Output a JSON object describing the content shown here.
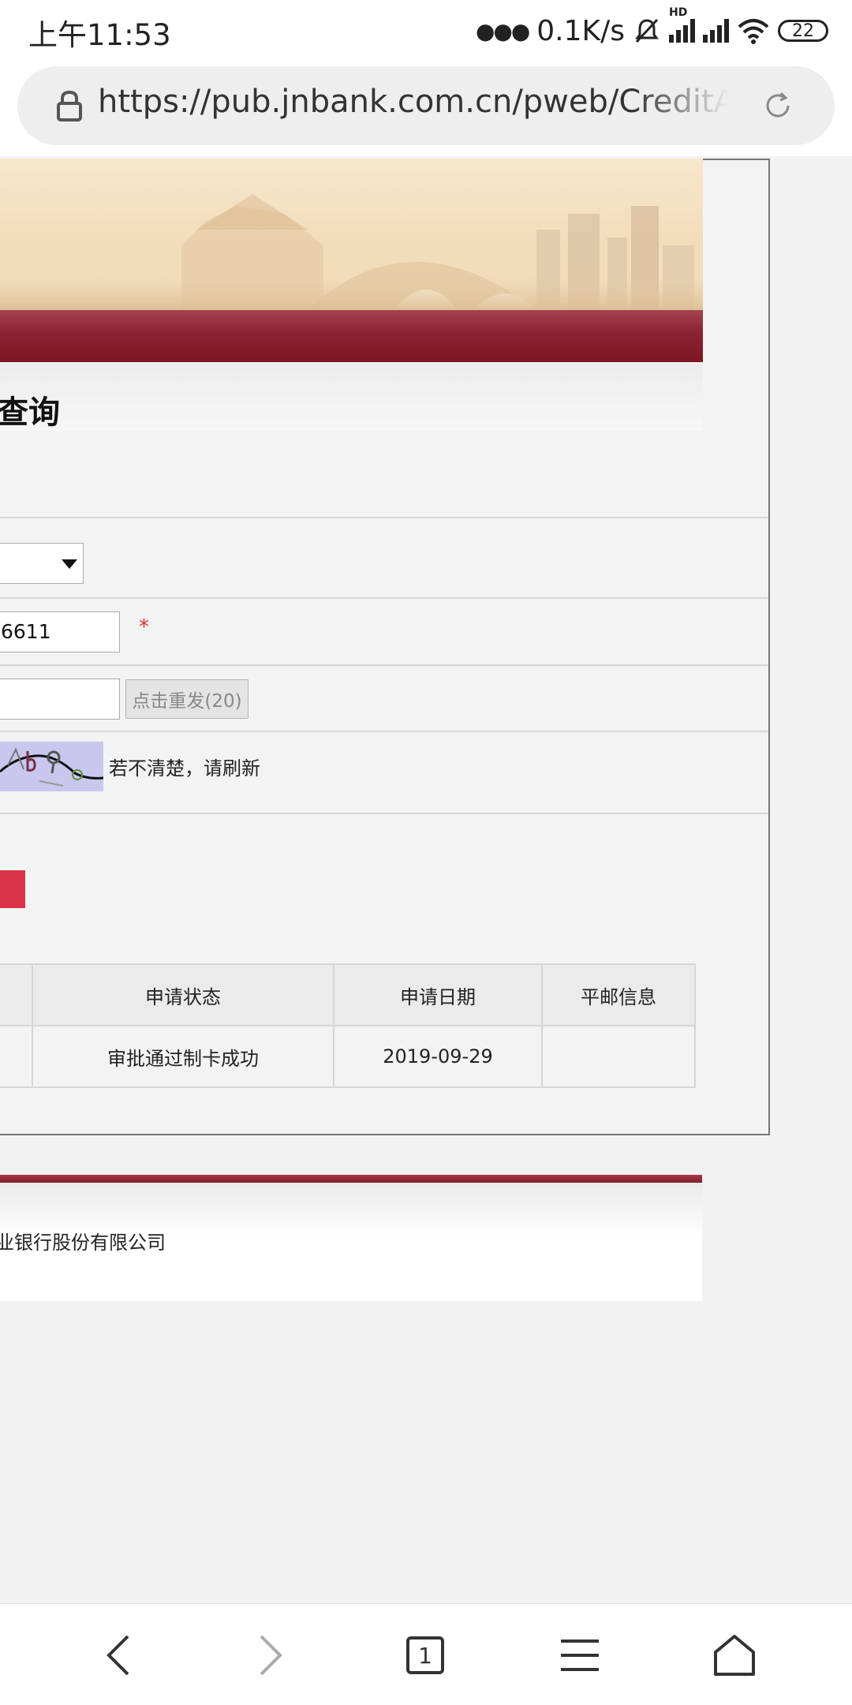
{
  "status_bar": {
    "time": "上午11:53",
    "network_speed": "0.1K/s",
    "hd_label": "HD",
    "battery": "22"
  },
  "browser": {
    "url": "https://pub.jnbank.com.cn/pweb/CreditAppl",
    "tab_count": "1"
  },
  "page": {
    "title": "查询",
    "form": {
      "phone_value": "6611",
      "required_mark": "*",
      "resend_label": "点击重发(20)",
      "captcha_hint": "若不清楚，请刷新"
    },
    "table": {
      "headers": [
        "申请状态",
        "申请日期",
        "平邮信息"
      ],
      "rows": [
        [
          "审批通过制卡成功",
          "2019-09-29",
          ""
        ]
      ]
    },
    "footer": {
      "text": "业银行股份有限公司"
    }
  },
  "colors": {
    "brand_red": "#8a2231",
    "submit_red": "#d9344a"
  }
}
